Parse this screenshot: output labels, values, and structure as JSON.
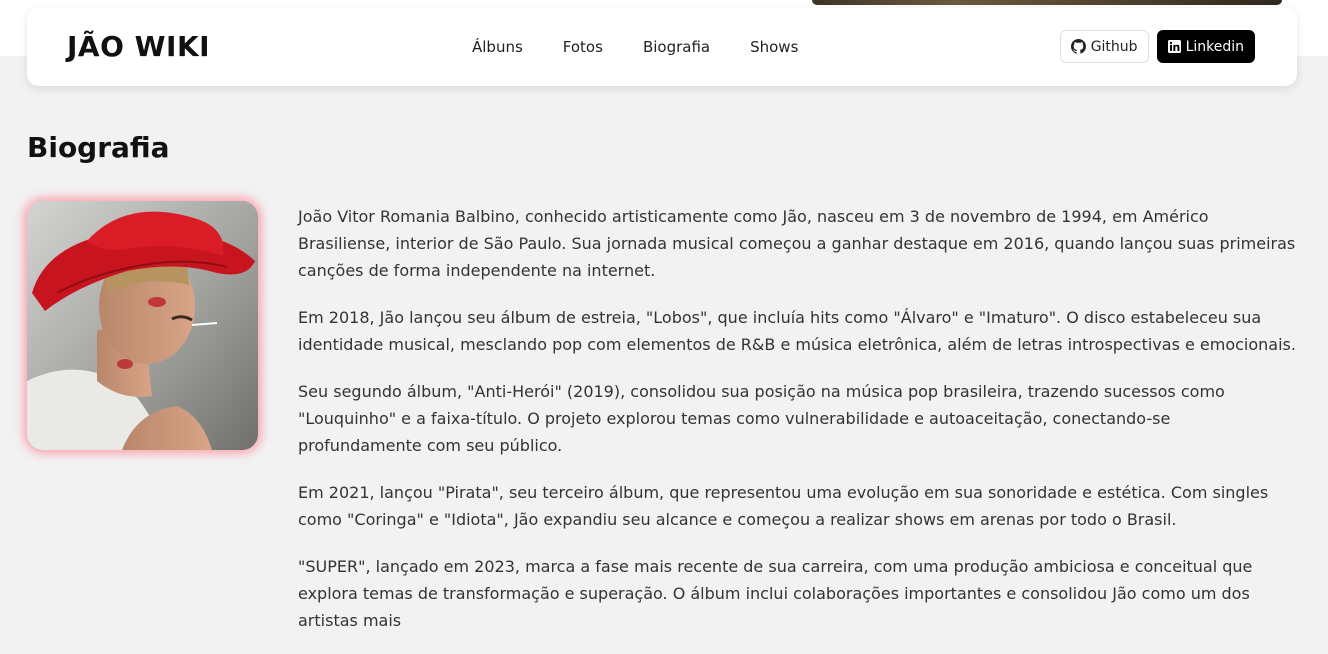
{
  "brand": "JÃO WIKI",
  "nav": [
    "Álbuns",
    "Fotos",
    "Biografia",
    "Shows"
  ],
  "buttons": {
    "github": "Github",
    "linkedin": "Linkedin"
  },
  "page_title": "Biografia",
  "paragraphs": [
    "João Vitor Romania Balbino, conhecido artisticamente como Jão, nasceu em 3 de novembro de 1994, em Américo Brasiliense, interior de São Paulo. Sua jornada musical começou a ganhar destaque em 2016, quando lançou suas primeiras canções de forma independente na internet.",
    "Em 2018, Jão lançou seu álbum de estreia, \"Lobos\", que incluía hits como \"Álvaro\" e \"Imaturo\". O disco estabeleceu sua identidade musical, mesclando pop com elementos de R&B e música eletrônica, além de letras introspectivas e emocionais.",
    "Seu segundo álbum, \"Anti-Herói\" (2019), consolidou sua posição na música pop brasileira, trazendo sucessos como \"Louquinho\" e a faixa-título. O projeto explorou temas como vulnerabilidade e autoaceitação, conectando-se profundamente com seu público.",
    "Em 2021, lançou \"Pirata\", seu terceiro álbum, que representou uma evolução em sua sonoridade e estética. Com singles como \"Coringa\" e \"Idiota\", Jão expandiu seu alcance e começou a realizar shows em arenas por todo o Brasil.",
    "\"SUPER\", lançado em 2023, marca a fase mais recente de sua carreira, com uma produção ambiciosa e conceitual que explora temas de transformação e superação. O álbum inclui colaborações importantes e consolidou Jão como um dos artistas mais"
  ],
  "colors": {
    "accent_glow": "#ff5a6e",
    "linkedin_bg": "#000000",
    "hat": "#c8141e"
  },
  "icons": {
    "github": "github-icon",
    "linkedin": "linkedin-icon"
  }
}
